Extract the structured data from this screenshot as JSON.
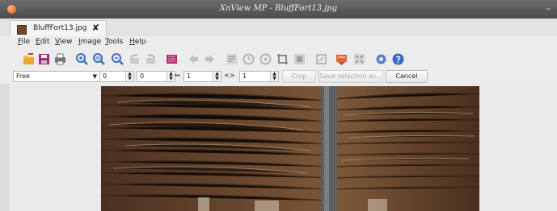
{
  "window": {
    "title": "XnView MP - BluffFort13.jpg",
    "minimize_glyph": "–",
    "app_icon": "xnview-logo-icon"
  },
  "tab": {
    "label": "BluffFort13.jpg",
    "close_glyph": "✘",
    "icon": "image-file-icon"
  },
  "menu": {
    "items": [
      "File",
      "Edit",
      "View",
      "Image",
      "Tools",
      "Help"
    ]
  },
  "toolbar": {
    "icons": [
      "browser-icon",
      "save-icon",
      "print-icon",
      "zoom-in-icon",
      "zoom-fit-icon",
      "zoom-out-icon",
      "rotate-left-icon",
      "rotate-right-icon",
      "color-palette-icon",
      "previous-icon",
      "next-icon",
      "info-icon",
      "histogram-icon",
      "adjust-icon",
      "crop-icon",
      "resize-icon",
      "transform-icon",
      "presentation-icon",
      "fullscreen-icon",
      "settings-icon",
      "help-icon"
    ]
  },
  "crop": {
    "ratio_value": "Free",
    "x_value": "0",
    "y_value": "0",
    "width_value": "1",
    "height_value": "1",
    "width_sep": "↔",
    "height_sep": "<>",
    "crop_label": "Crop",
    "save_selection_label": "Save selection as...",
    "cancel_label": "Cancel"
  },
  "image": {
    "description_icon": "photo-wooden-interior"
  }
}
